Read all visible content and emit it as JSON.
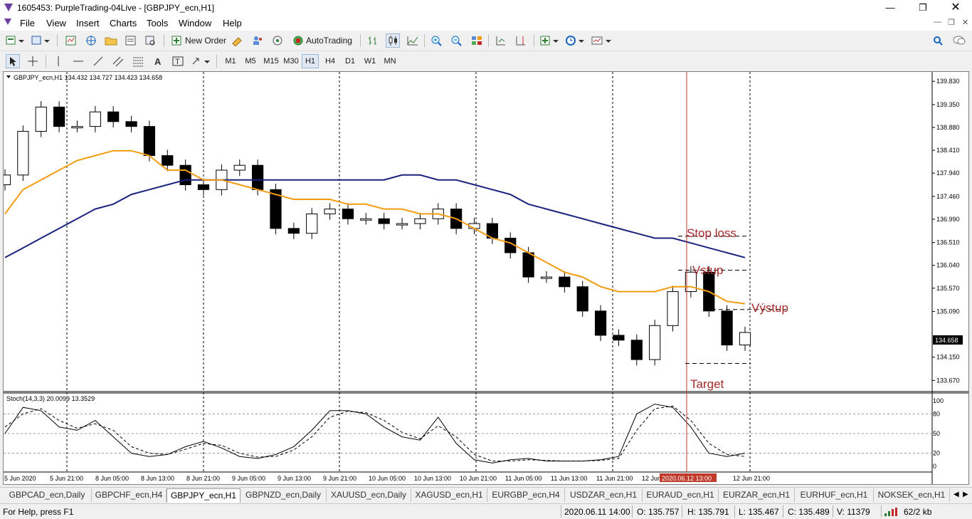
{
  "window": {
    "title": "1605453: PurpleTrading-04Live - [GBPJPY_ecn,H1]"
  },
  "menu": [
    "File",
    "View",
    "Insert",
    "Charts",
    "Tools",
    "Window",
    "Help"
  ],
  "toolbar": {
    "new_order": "New Order",
    "auto_trading": "AutoTrading"
  },
  "timeframes": [
    "M1",
    "M5",
    "M15",
    "M30",
    "H1",
    "H4",
    "D1",
    "W1",
    "MN"
  ],
  "active_timeframe": "H1",
  "chart": {
    "header": "GBPJPY_ecn,H1  134.432 134.727 134.423 134.658",
    "price_labels": [
      "139.830",
      "139.350",
      "138.880",
      "138.410",
      "137.940",
      "137.460",
      "136.990",
      "136.510",
      "136.040",
      "135.570",
      "135.090",
      "134.150",
      "133.670"
    ],
    "current_price": "134.658",
    "time_labels": [
      "5 Jun 2020",
      "5 Jun 21:00",
      "8 Jun 05:00",
      "8 Jun 13:00",
      "8 Jun 21:00",
      "9 Jun 05:00",
      "9 Jun 13:00",
      "9 Jun 21:00",
      "10 Jun 05:00",
      "10 Jun 13:00",
      "10 Jun 21:00",
      "11 Jun 05:00",
      "11 Jun 13:00",
      "11 Jun 21:00",
      "12 Jun 05:00",
      "2020.06.12 13:00",
      "12 Jun 21:00"
    ],
    "cursor_time": "2020.06.12 13:00",
    "annotations": {
      "stop_loss": "Stop loss",
      "entry": "Vstup",
      "exit": "Výstup",
      "target": "Target"
    },
    "stoch_header": "Stoch(14,3,3) 20.0099 13.3529",
    "stoch_levels": [
      "100",
      "80",
      "50",
      "20",
      "0"
    ],
    "colors": {
      "ma_fast": "#f39c12",
      "ma_slow": "#1a237e",
      "marker": "#c0392b",
      "annotation_text": "#a52a2a"
    }
  },
  "chart_data": {
    "type": "line",
    "title": "GBPJPY_ecn,H1",
    "ylim": [
      133.5,
      139.95
    ],
    "x": [
      0,
      4,
      8,
      12,
      16,
      20,
      24,
      28,
      32,
      36,
      40,
      44,
      48,
      52,
      56,
      60,
      64,
      68,
      72,
      76,
      80,
      84,
      88,
      92,
      96,
      100,
      104,
      108,
      112,
      116,
      120,
      124,
      128,
      132,
      136,
      140,
      144,
      148,
      152,
      156,
      160,
      164
    ],
    "series": [
      {
        "name": "close",
        "values": [
          137.9,
          138.8,
          139.3,
          138.9,
          138.9,
          139.2,
          139.0,
          138.9,
          138.3,
          138.1,
          137.7,
          137.6,
          138.0,
          138.1,
          137.6,
          136.8,
          136.7,
          137.1,
          137.2,
          137.0,
          137.0,
          136.9,
          136.9,
          137.0,
          137.2,
          136.8,
          136.9,
          136.6,
          136.3,
          135.8,
          135.8,
          135.6,
          135.1,
          134.6,
          134.5,
          134.1,
          134.8,
          135.5,
          135.9,
          135.1,
          134.4,
          134.658
        ]
      },
      {
        "name": "ma_fast",
        "values": [
          137.1,
          137.6,
          137.8,
          138.0,
          138.2,
          138.3,
          138.4,
          138.4,
          138.3,
          138.0,
          138.0,
          137.8,
          137.8,
          137.7,
          137.6,
          137.5,
          137.4,
          137.4,
          137.4,
          137.3,
          137.3,
          137.2,
          137.2,
          137.1,
          137.1,
          137.0,
          136.8,
          136.6,
          136.5,
          136.3,
          136.1,
          135.9,
          135.8,
          135.6,
          135.5,
          135.5,
          135.5,
          135.6,
          135.6,
          135.5,
          135.3,
          135.25
        ]
      },
      {
        "name": "ma_slow",
        "values": [
          136.2,
          136.4,
          136.6,
          136.8,
          137.0,
          137.2,
          137.3,
          137.5,
          137.6,
          137.7,
          137.8,
          137.8,
          137.8,
          137.8,
          137.8,
          137.8,
          137.8,
          137.8,
          137.8,
          137.8,
          137.8,
          137.8,
          137.9,
          137.9,
          137.8,
          137.8,
          137.7,
          137.6,
          137.5,
          137.3,
          137.2,
          137.1,
          137.0,
          136.9,
          136.8,
          136.7,
          136.6,
          136.6,
          136.5,
          136.4,
          136.3,
          136.2
        ]
      },
      {
        "name": "stoch_main",
        "values": [
          50,
          90,
          85,
          60,
          55,
          70,
          45,
          20,
          15,
          18,
          30,
          38,
          28,
          15,
          12,
          18,
          30,
          55,
          85,
          85,
          80,
          60,
          45,
          40,
          75,
          35,
          10,
          5,
          10,
          12,
          8,
          8,
          8,
          10,
          15,
          80,
          95,
          90,
          60,
          20,
          15,
          20
        ]
      },
      {
        "name": "stoch_signal",
        "values": [
          60,
          80,
          88,
          70,
          58,
          65,
          55,
          30,
          20,
          18,
          26,
          35,
          32,
          20,
          14,
          15,
          25,
          45,
          75,
          84,
          82,
          70,
          52,
          42,
          62,
          45,
          18,
          8,
          8,
          10,
          9,
          8,
          8,
          9,
          12,
          55,
          88,
          92,
          70,
          35,
          18,
          15
        ]
      }
    ],
    "levels": {
      "stop_loss": 136.64,
      "entry": 135.94,
      "exit": 135.13,
      "target": 134.02
    }
  },
  "tabs": [
    "GBPCAD_ecn,Daily",
    "GBPCHF_ecn,H4",
    "GBPJPY_ecn,H1",
    "GBPNZD_ecn,Daily",
    "XAUUSD_ecn,Daily",
    "XAGUSD_ecn,H1",
    "EURGBP_ecn,H4",
    "USDZAR_ecn,H1",
    "EURAUD_ecn,H1",
    "EURZAR_ecn,H1",
    "EURHUF_ecn,H1",
    "NOKSEK_ecn,H1"
  ],
  "active_tab": "GBPJPY_ecn,H1",
  "status": {
    "help": "For Help, press F1",
    "time": "2020.06.11 14:00",
    "open": "O: 135.757",
    "high": "H: 135.791",
    "low": "L: 135.467",
    "close": "C: 135.489",
    "volume": "V: 11379",
    "traffic": "62/2 kb"
  }
}
